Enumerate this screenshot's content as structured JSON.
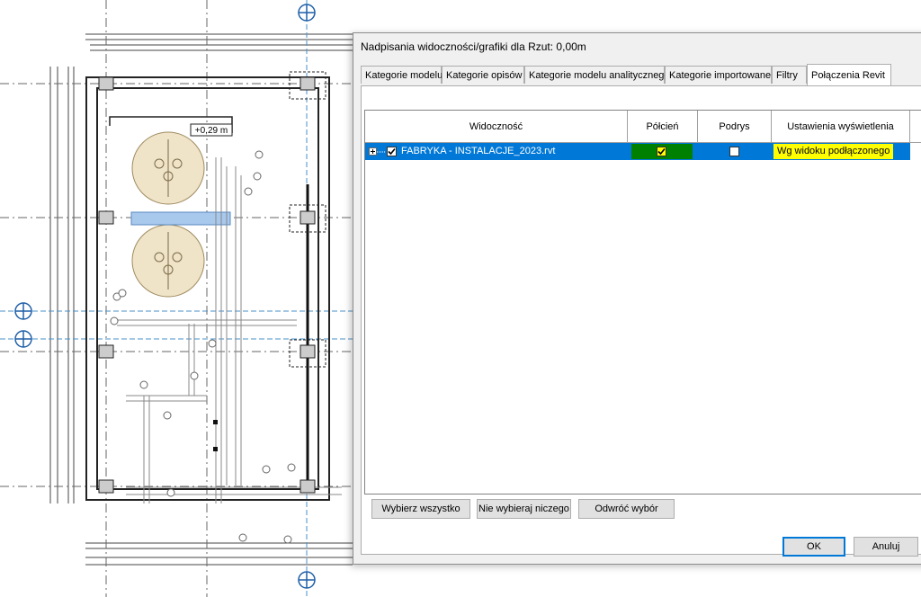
{
  "drawing": {
    "elevation_tag": "+0,29 m"
  },
  "dialog": {
    "title": "Nadpisania widoczności/grafiki dla Rzut: 0,00m",
    "tabs": [
      {
        "label": "Kategorie modelu"
      },
      {
        "label": "Kategorie opisów"
      },
      {
        "label": "Kategorie modelu analitycznego"
      },
      {
        "label": "Kategorie importowane"
      },
      {
        "label": "Filtry"
      },
      {
        "label": "Połączenia Revit",
        "active": true
      }
    ],
    "grid": {
      "columns": [
        "Widoczność",
        "Półcień",
        "Podrys",
        "Ustawienia wyświetlenia"
      ],
      "rows": [
        {
          "name": "FABRYKA - INSTALACJE_2023.rvt",
          "visible": true,
          "halftone": true,
          "underlay": false,
          "display_settings": "Wg widoku podłączonego"
        }
      ]
    },
    "buttons": {
      "select_all": "Wybierz wszystko",
      "select_none": "Nie wybieraj niczego",
      "invert": "Odwróć wybór",
      "ok": "OK",
      "cancel": "Anuluj"
    },
    "colors": {
      "selection": "#0078d7",
      "halftone_cell": "#008000",
      "highlight": "#ffff00"
    }
  }
}
